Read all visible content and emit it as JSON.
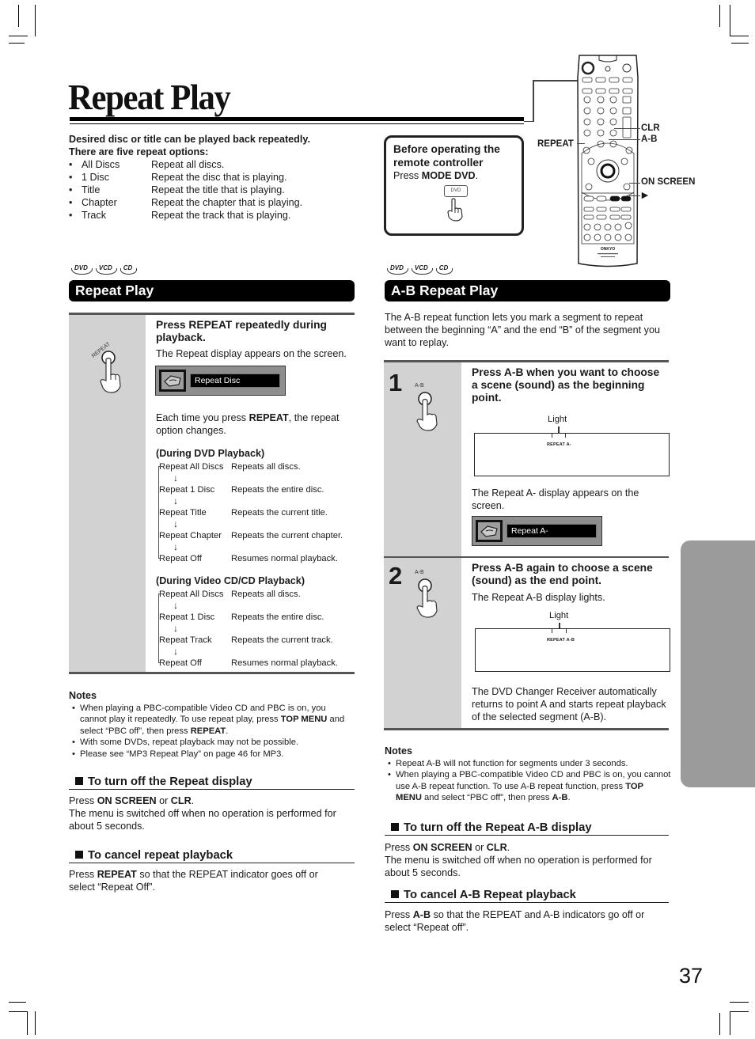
{
  "page": {
    "title": "Repeat Play",
    "page_number": "37"
  },
  "intro": {
    "lead_line1": "Desired disc or title can be played back repeatedly.",
    "lead_line2": "There are five repeat options:",
    "options": [
      {
        "name": "All Discs",
        "desc": "Repeat all discs."
      },
      {
        "name": "1 Disc",
        "desc": "Repeat the disc that is playing."
      },
      {
        "name": "Title",
        "desc": "Repeat the title that is playing."
      },
      {
        "name": "Chapter",
        "desc": "Repeat the chapter that is playing."
      },
      {
        "name": "Track",
        "desc": "Repeat the track that is playing."
      }
    ]
  },
  "before_box": {
    "heading_line1": "Before operating the",
    "heading_line2": "remote controller",
    "press": "Press ",
    "press_bold": "MODE DVD",
    "press_end": ".",
    "button_label": "DVD"
  },
  "remote": {
    "labels": {
      "repeat": "REPEAT",
      "clr": "CLR",
      "ab": "A-B",
      "on_screen": "ON SCREEN",
      "play": "►"
    },
    "brand": "ONKYO"
  },
  "disc_badges": [
    "DVD",
    "VCD",
    "CD"
  ],
  "repeat_play": {
    "header": "Repeat Play",
    "button_label": "REPEAT",
    "step_heading": "Press REPEAT repeatedly during playback.",
    "step_text": "The Repeat display appears on the screen.",
    "osd_text": "Repeat Disc",
    "each_time_pre": "Each time you press ",
    "each_time_bold": "REPEAT",
    "each_time_post": ", the repeat option changes.",
    "dvd_sequence": {
      "heading": "(During DVD Playback)",
      "items": [
        {
          "name": "Repeat All Discs",
          "desc": "Repeats all discs."
        },
        {
          "name": "Repeat 1 Disc",
          "desc": "Repeats the entire disc."
        },
        {
          "name": "Repeat Title",
          "desc": "Repeats the current title."
        },
        {
          "name": "Repeat Chapter",
          "desc": "Repeats the current chapter."
        },
        {
          "name": "Repeat Off",
          "desc": "Resumes normal playback."
        }
      ]
    },
    "cd_sequence": {
      "heading": "(During Video CD/CD Playback)",
      "items": [
        {
          "name": "Repeat All Discs",
          "desc": "Repeats all discs."
        },
        {
          "name": "Repeat 1 Disc",
          "desc": "Repeats the entire disc."
        },
        {
          "name": "Repeat Track",
          "desc": "Repeats the current track."
        },
        {
          "name": "Repeat Off",
          "desc": "Resumes normal playback."
        }
      ]
    },
    "arrow": "↓",
    "notes": {
      "heading": "Notes",
      "items": [
        {
          "pre": "When playing a PBC-compatible Video CD and PBC is on, you cannot play it repeatedly. To use repeat play, press ",
          "b1": "TOP MENU",
          "mid": " and select “PBC off”, then press ",
          "b2": "REPEAT",
          "post": "."
        },
        {
          "pre": "With some DVDs, repeat playback may not be possible.",
          "b1": "",
          "mid": "",
          "b2": "",
          "post": ""
        },
        {
          "pre": "Please see “MP3 Repeat Play” on page 46 for MP3.",
          "b1": "",
          "mid": "",
          "b2": "",
          "post": ""
        }
      ]
    },
    "turn_off": {
      "heading": "To turn off the Repeat display",
      "press": "Press ",
      "b1": "ON SCREEN",
      "or": " or ",
      "b2": "CLR",
      "end": ".",
      "text": "The menu is switched off when no operation is performed for about 5 seconds."
    },
    "cancel": {
      "heading": "To cancel repeat playback",
      "press": "Press ",
      "b1": "REPEAT",
      "text": " so that the REPEAT indicator goes off or select “Repeat Off”."
    }
  },
  "ab_repeat": {
    "header": "A-B Repeat Play",
    "intro": "The A-B repeat function lets you mark a segment to repeat between the beginning “A” and the end “B” of the segment you want to replay.",
    "step1": {
      "number": "1",
      "button_label": "A-B",
      "heading": "Press A-B when you want to choose a scene (sound) as the beginning point.",
      "light_label": "Light",
      "display_text": "REPEAT A-",
      "text": "The Repeat A- display appears on the screen.",
      "osd_text": "Repeat A-"
    },
    "step2": {
      "number": "2",
      "button_label": "A-B",
      "heading": "Press A-B again to choose a scene (sound) as the end point.",
      "text": "The Repeat A-B display lights.",
      "light_label": "Light",
      "display_text": "REPEAT A-B",
      "text2": "The DVD Changer Receiver automatically returns to point A and starts repeat playback of the selected segment (A-B)."
    },
    "notes": {
      "heading": "Notes",
      "items": [
        {
          "pre": "Repeat A-B will not function for segments under 3 seconds.",
          "b1": "",
          "mid": "",
          "b2": "",
          "post": ""
        },
        {
          "pre": "When playing a PBC-compatible Video CD and PBC is on, you cannot use A-B repeat function. To use A-B repeat function, press ",
          "b1": "TOP MENU",
          "mid": " and select “PBC off”, then press ",
          "b2": "A-B",
          "post": "."
        }
      ]
    },
    "turn_off": {
      "heading": "To turn off the Repeat A-B display",
      "press": "Press ",
      "b1": "ON SCREEN",
      "or": " or ",
      "b2": "CLR",
      "end": ".",
      "text": "The menu is switched off when no operation is performed for about 5 seconds."
    },
    "cancel": {
      "heading": "To cancel A-B Repeat playback",
      "press": "Press ",
      "b1": "A-B",
      "text": " so that the REPEAT and A-B indicators go off or select “Repeat off”."
    }
  },
  "colors": {
    "panel_gray": "#d2d2d2",
    "side_tab": "#9b9b9b",
    "osd_bg": "#8e8e8e",
    "header_bg": "#000000"
  }
}
